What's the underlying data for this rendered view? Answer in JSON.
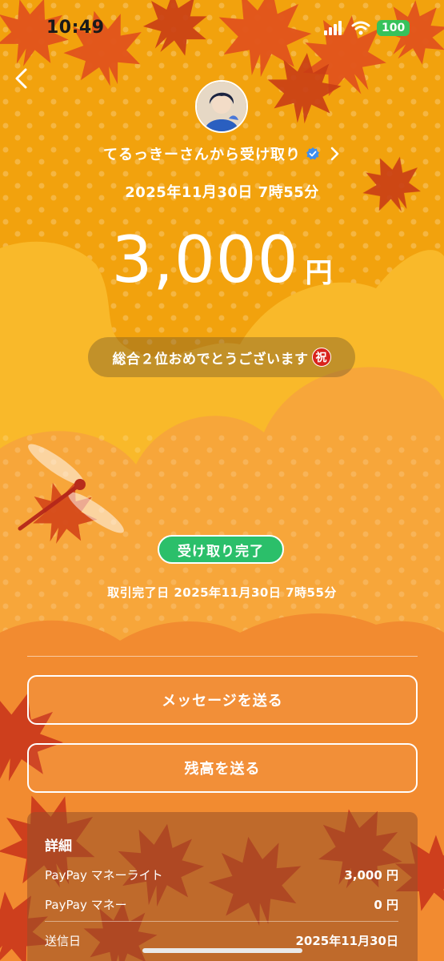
{
  "status_bar": {
    "time": "10:49",
    "battery": "100"
  },
  "sender": {
    "text": "てるっきーさんから受け取り"
  },
  "payment": {
    "datetime": "2025年11月30日 7時55分",
    "amount": "3,000",
    "currency": "円",
    "message": "総合２位おめでとうございます",
    "message_emoji": "祝"
  },
  "status": {
    "badge": "受け取り完了",
    "complete_label": "取引完了日",
    "complete_date": "2025年11月30日 7時55分"
  },
  "actions": {
    "send_message": "メッセージを送る",
    "send_balance": "残高を送る"
  },
  "details": {
    "title": "詳細",
    "rows": [
      {
        "label": "PayPay マネーライト",
        "value": "3,000 円"
      },
      {
        "label": "PayPay マネー",
        "value": "0 円"
      },
      {
        "label": "送信日",
        "value": "2025年11月30日"
      }
    ]
  },
  "colors": {
    "background": "#f4a30e",
    "badge_green": "#2bbf6a",
    "verified_blue": "#3d8ef0"
  }
}
